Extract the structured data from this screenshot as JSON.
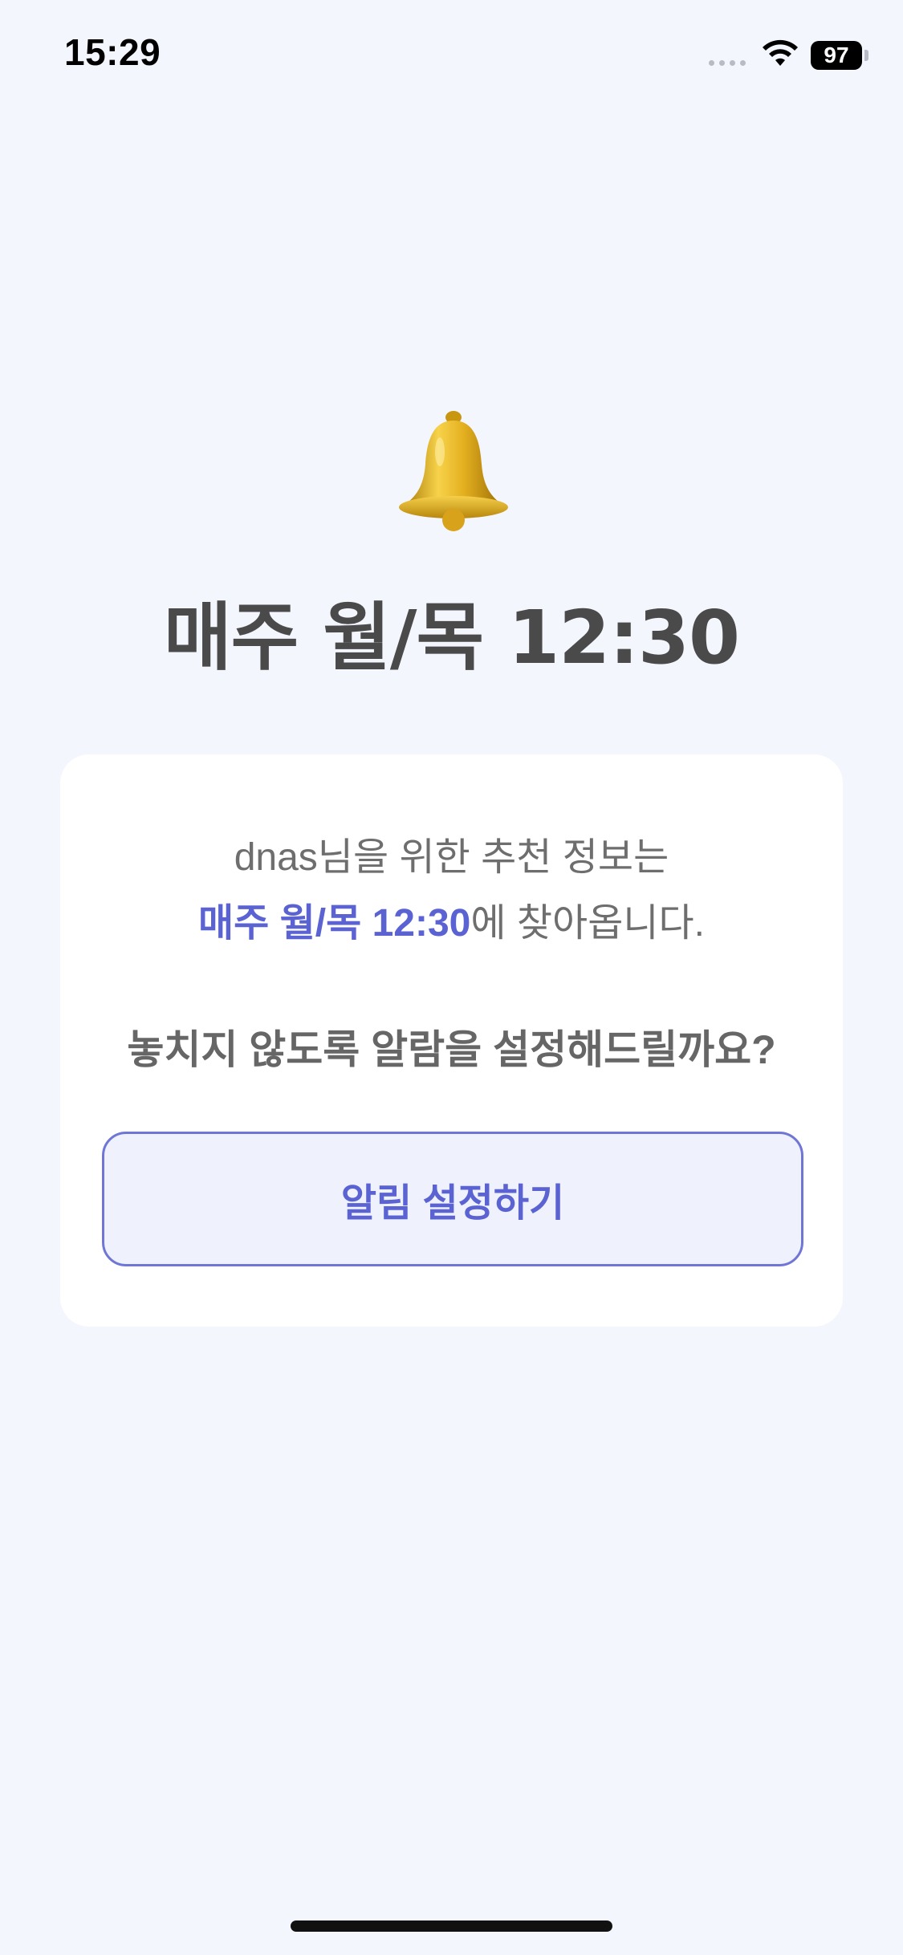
{
  "status_bar": {
    "time": "15:29",
    "battery_level": "97",
    "wifi_icon": "wifi-icon",
    "signal_icon": "signal-dots-icon"
  },
  "hero": {
    "icon": "bell-icon",
    "title": "매주 월/목 12:30"
  },
  "card": {
    "intro": "dnas님을 위한 추천 정보는",
    "schedule_highlight": "매주 월/목 12:30",
    "schedule_suffix": "에 찾아옵니다.",
    "question": "놓치지 않도록 알람을 설정해드릴까요?",
    "button_label": "알림 설정하기"
  },
  "colors": {
    "background": "#f3f6fd",
    "accent": "#5b63d3",
    "button_border": "#6f76d6",
    "button_fill": "#eff1fd",
    "title_text": "#4a4a4a",
    "body_text": "#6e6e6e"
  }
}
